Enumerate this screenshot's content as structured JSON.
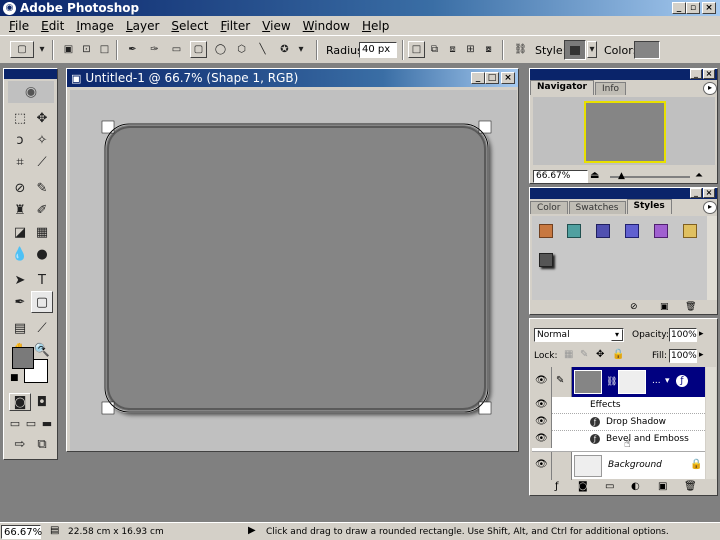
{
  "app": {
    "title": "Adobe Photoshop"
  },
  "menu": [
    "File",
    "Edit",
    "Image",
    "Layer",
    "Select",
    "Filter",
    "View",
    "Window",
    "Help"
  ],
  "options": {
    "radius_label": "Radius:",
    "radius_value": "40 px",
    "style_label": "Style:",
    "color_label": "Color:"
  },
  "document": {
    "title": "Untitled-1 @ 66.7% (Shape 1, RGB)"
  },
  "navigator": {
    "tabs": [
      "Navigator",
      "Info"
    ],
    "zoom": "66.67%"
  },
  "styles_panel": {
    "tabs": [
      "Color",
      "Swatches",
      "Styles"
    ]
  },
  "layers": {
    "blend_mode": "Normal",
    "opacity_label": "Opacity:",
    "opacity": "100%",
    "lock_label": "Lock:",
    "fill_label": "Fill:",
    "fill": "100%",
    "effects_label": "Effects",
    "effect_1": "Drop Shadow",
    "effect_2": "Bevel and Emboss",
    "background_label": "Background"
  },
  "status": {
    "zoom": "66.67%",
    "doc_size": "22.58 cm x 16.93 cm",
    "hint": "Click and drag to draw a rounded rectangle.  Use Shift, Alt, and Ctrl for additional options."
  },
  "colors": {
    "accent": "#0a246a",
    "shape_fill": "#858585",
    "selection": "#000080"
  }
}
